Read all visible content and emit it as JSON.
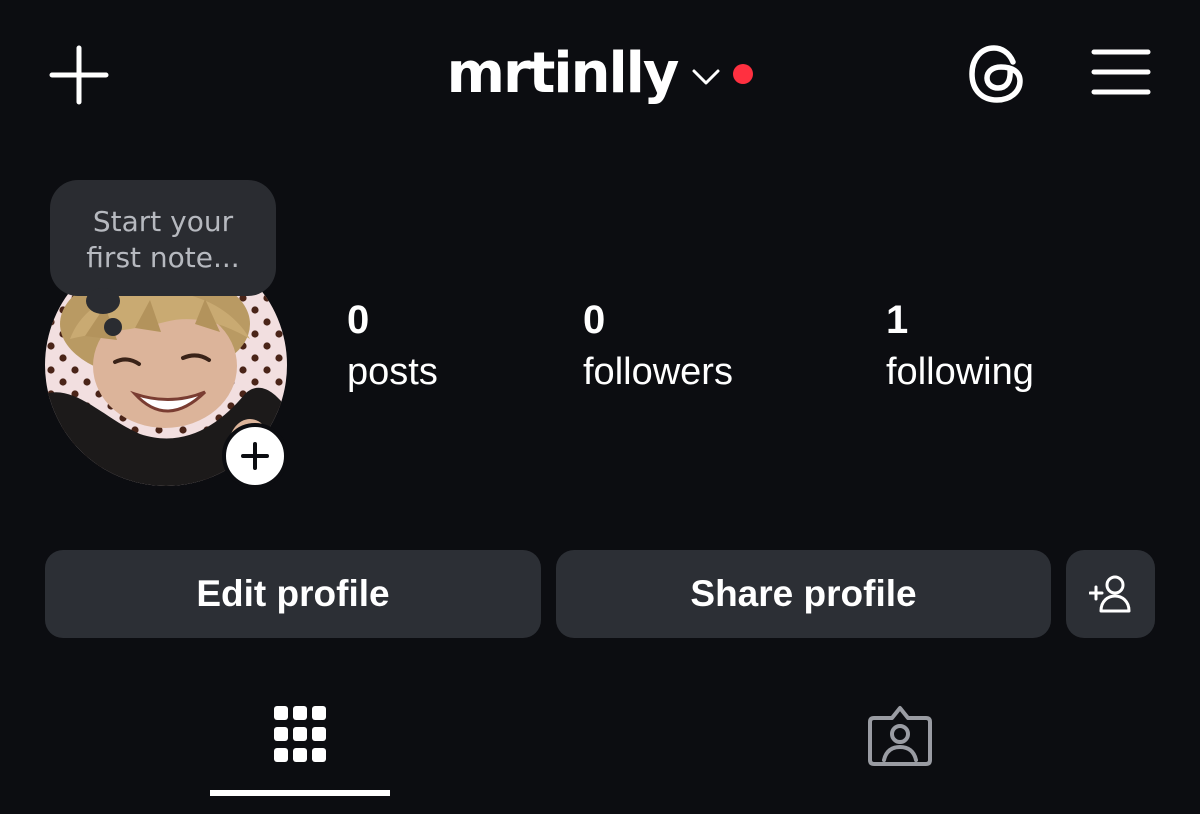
{
  "header": {
    "username": "mrtinlly",
    "new_post_icon": "plus-icon",
    "dropdown_icon": "chevron-down-icon",
    "threads_icon": "threads-icon",
    "menu_icon": "hamburger-menu-icon",
    "notification_color": "#ff3040"
  },
  "profile": {
    "note_placeholder": "Start your first note...",
    "note_line1": "Start your",
    "note_line2": "first note...",
    "add_story_icon": "plus-icon"
  },
  "stats": {
    "posts": {
      "count": "0",
      "label": "posts"
    },
    "followers": {
      "count": "0",
      "label": "followers"
    },
    "following": {
      "count": "1",
      "label": "following"
    }
  },
  "actions": {
    "edit_label": "Edit profile",
    "share_label": "Share profile",
    "discover_icon": "add-person-icon"
  },
  "tabs": {
    "items": [
      {
        "icon": "grid-icon",
        "active": true
      },
      {
        "icon": "tagged-person-icon",
        "active": false
      }
    ]
  },
  "colors": {
    "background": "#0c0d11",
    "button": "#2c2f35",
    "note_bubble": "#2a2c31",
    "text": "#ffffff"
  }
}
